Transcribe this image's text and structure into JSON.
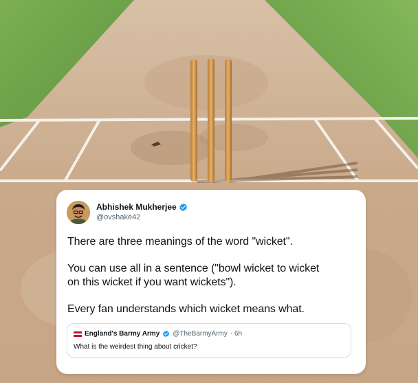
{
  "tweet": {
    "author_name": "Abhishek Mukherjee",
    "author_handle": "@ovshake42",
    "lines": [
      "There are three meanings of the word \"wicket\".",
      "You can use all in a sentence (\"bowl wicket to wicket",
      "on this wicket if you want wickets\").",
      "Every fan understands which wicket means what."
    ],
    "quoted": {
      "author_name": "England's Barmy Army",
      "author_handle": "@TheBarmyArmy",
      "time": "· 6h",
      "text": "What is the weirdest thing about cricket?"
    }
  },
  "scene": {
    "icons": [
      "avatar",
      "verified-icon",
      "england-flag-icon"
    ],
    "colors": {
      "grass": "#6fa04a",
      "pitch": "#c9a98a",
      "crease": "#f4f1ea",
      "stump": "#d59a4f",
      "verified": "#1d9bf0"
    }
  }
}
